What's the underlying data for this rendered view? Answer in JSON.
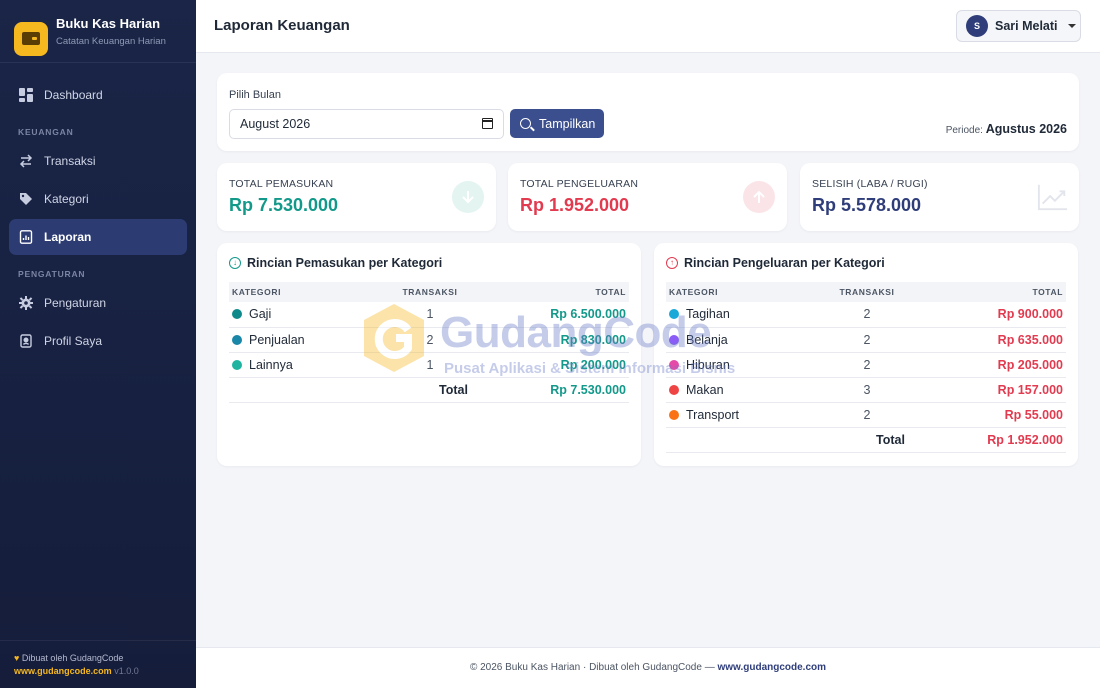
{
  "brand": {
    "title": "Buku Kas Harian",
    "subtitle": "Catatan Keuangan Harian"
  },
  "nav": {
    "dashboard": "Dashboard",
    "section_keuangan": "KEUANGAN",
    "transaksi": "Transaksi",
    "kategori": "Kategori",
    "laporan": "Laporan",
    "section_pengaturan": "PENGATURAN",
    "pengaturan": "Pengaturan",
    "profil": "Profil Saya"
  },
  "sidebar_footer": {
    "made_by": "Dibuat oleh GudangCode",
    "link": "www.gudangcode.com",
    "version": "v1.0.0"
  },
  "header": {
    "title": "Laporan Keuangan",
    "user_initial": "S",
    "user_name": "Sari Melati"
  },
  "filter": {
    "label": "Pilih Bulan",
    "month_value": "August 2026",
    "button": "Tampilkan",
    "periode_label": "Periode:",
    "periode_value": "Agustus 2026"
  },
  "stats": {
    "income": {
      "label": "TOTAL PEMASUKAN",
      "value": "Rp 7.530.000"
    },
    "expense": {
      "label": "TOTAL PENGELUARAN",
      "value": "Rp 1.952.000"
    },
    "diff": {
      "label": "SELISIH (LABA / RUGI)",
      "value": "Rp 5.578.000"
    }
  },
  "income_table": {
    "title": "Rincian Pemasukan per Kategori",
    "headers": [
      "KATEGORI",
      "TRANSAKSI",
      "TOTAL"
    ],
    "rows": [
      {
        "name": "Gaji",
        "count": "1",
        "total": "Rp 6.500.000",
        "color": "#0f8a8a"
      },
      {
        "name": "Penjualan",
        "count": "2",
        "total": "Rp 830.000",
        "color": "#1a86a8"
      },
      {
        "name": "Lainnya",
        "count": "1",
        "total": "Rp 200.000",
        "color": "#1fb3a0"
      }
    ],
    "total_label": "Total",
    "total_value": "Rp 7.530.000"
  },
  "expense_table": {
    "title": "Rincian Pengeluaran per Kategori",
    "headers": [
      "KATEGORI",
      "TRANSAKSI",
      "TOTAL"
    ],
    "rows": [
      {
        "name": "Tagihan",
        "count": "2",
        "total": "Rp 900.000",
        "color": "#19a9d8"
      },
      {
        "name": "Belanja",
        "count": "2",
        "total": "Rp 635.000",
        "color": "#8b5cf6"
      },
      {
        "name": "Hiburan",
        "count": "2",
        "total": "Rp 205.000",
        "color": "#e64aa8"
      },
      {
        "name": "Makan",
        "count": "3",
        "total": "Rp 157.000",
        "color": "#ef4444"
      },
      {
        "name": "Transport",
        "count": "2",
        "total": "Rp 55.000",
        "color": "#f97316"
      }
    ],
    "total_label": "Total",
    "total_value": "Rp 1.952.000"
  },
  "watermark": {
    "title": "GudangCode",
    "subtitle": "Pusat Aplikasi & Sistem Informasi Bisnis"
  },
  "footer": {
    "text": "© 2026 Buku Kas Harian · Dibuat oleh GudangCode —",
    "link": "www.gudangcode.com"
  }
}
